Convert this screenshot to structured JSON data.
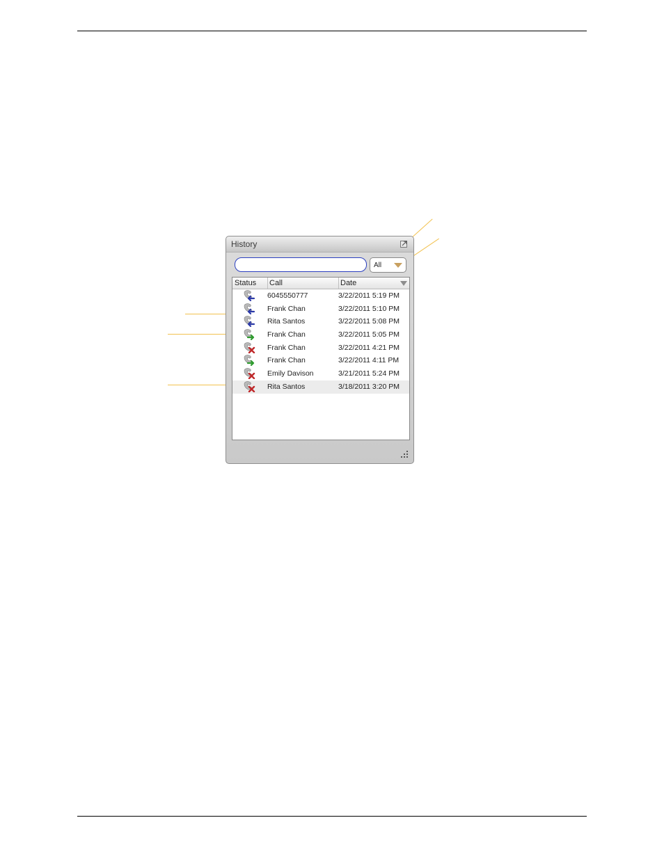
{
  "window": {
    "title": "History",
    "filter": {
      "selected": "All"
    },
    "search": {
      "value": "",
      "placeholder": ""
    },
    "columns": {
      "status": "Status",
      "call": "Call",
      "date": "Date"
    },
    "rows": [
      {
        "status_icon": "outgoing-call-icon",
        "call": "6045550777",
        "date": "3/22/2011 5:19 PM"
      },
      {
        "status_icon": "outgoing-call-icon",
        "call": "Frank Chan",
        "date": "3/22/2011 5:10 PM"
      },
      {
        "status_icon": "outgoing-call-icon",
        "call": "Rita Santos",
        "date": "3/22/2011 5:08 PM"
      },
      {
        "status_icon": "incoming-call-icon",
        "call": "Frank Chan",
        "date": "3/22/2011 5:05 PM"
      },
      {
        "status_icon": "missed-call-icon",
        "call": "Frank Chan",
        "date": "3/22/2011 4:21 PM"
      },
      {
        "status_icon": "incoming-call-icon",
        "call": "Frank Chan",
        "date": "3/22/2011 4:11 PM"
      },
      {
        "status_icon": "missed-call-icon",
        "call": "Emily Davison",
        "date": "3/21/2011 5:24 PM"
      },
      {
        "status_icon": "missed-call-icon",
        "call": "Rita Santos",
        "date": "3/18/2011 3:20 PM"
      }
    ],
    "selected_row": 7
  },
  "colors": {
    "outgoing": "#2c3aa8",
    "incoming": "#2e9b2e",
    "missed": "#c0282a",
    "callout": "#f2c14e",
    "search_border": "#2b3fc0"
  }
}
